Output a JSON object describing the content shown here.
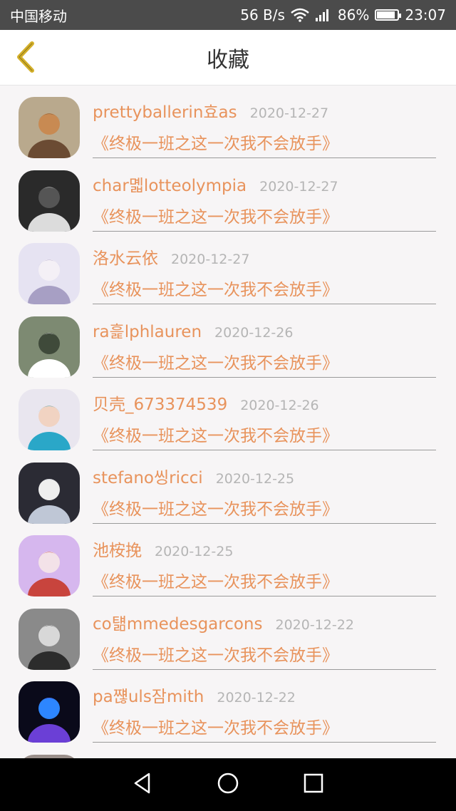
{
  "status": {
    "carrier": "中国移动",
    "speed": "56 B/s",
    "battery": "86%",
    "time": "23:07",
    "icons": [
      "wifi-icon",
      "signal-icon",
      "battery-icon"
    ]
  },
  "header": {
    "title": "收藏",
    "back_icon": "chevron-left-icon"
  },
  "items": [
    {
      "name": "prettyballerin효as",
      "date": "2020-12-27",
      "book": "《终极一班之这一次我不会放手》",
      "colors": [
        "#b9a98d",
        "#6b4b33",
        "#c88a52"
      ]
    },
    {
      "name": "char몗lotteolympia",
      "date": "2020-12-27",
      "book": "《终极一班之这一次我不会放手》",
      "colors": [
        "#2a2a2a",
        "#dcdcdc",
        "#555555"
      ]
    },
    {
      "name": "洛水云依",
      "date": "2020-12-27",
      "book": "《终极一班之这一次我不会放手》",
      "colors": [
        "#e6e3f2",
        "#a79fc4",
        "#f4f0f6"
      ]
    },
    {
      "name": "ra흝lphlauren",
      "date": "2020-12-26",
      "book": "《终极一班之这一次我不会放手》",
      "colors": [
        "#7d8a72",
        "#ffffff",
        "#3f4a3a"
      ]
    },
    {
      "name": "贝壳_673374539",
      "date": "2020-12-26",
      "book": "《终极一班之这一次我不会放手》",
      "colors": [
        "#e9e6ef",
        "#2aa7c8",
        "#f1d3c2"
      ]
    },
    {
      "name": "stefano씽ricci",
      "date": "2020-12-25",
      "book": "《终极一班之这一次我不会放手》",
      "colors": [
        "#2b2b34",
        "#bfc7d6",
        "#eeeeee"
      ]
    },
    {
      "name": "池桉挽",
      "date": "2020-12-25",
      "book": "《终极一班之这一次我不会放手》",
      "colors": [
        "#d6b7ee",
        "#c8443d",
        "#f3e2e8"
      ]
    },
    {
      "name": "co턞mmedesgarcons",
      "date": "2020-12-22",
      "book": "《终极一班之这一次我不会放手》",
      "colors": [
        "#8a8a8a",
        "#2c2c2c",
        "#d8d8d8"
      ]
    },
    {
      "name": "pa쨶uls잠mith",
      "date": "2020-12-22",
      "book": "《终极一班之这一次我不会放手》",
      "colors": [
        "#0a0a1a",
        "#6b3fd6",
        "#2d86ff"
      ]
    }
  ],
  "nav": {
    "icons": [
      "back-triangle-icon",
      "home-circle-icon",
      "recents-square-icon"
    ]
  }
}
